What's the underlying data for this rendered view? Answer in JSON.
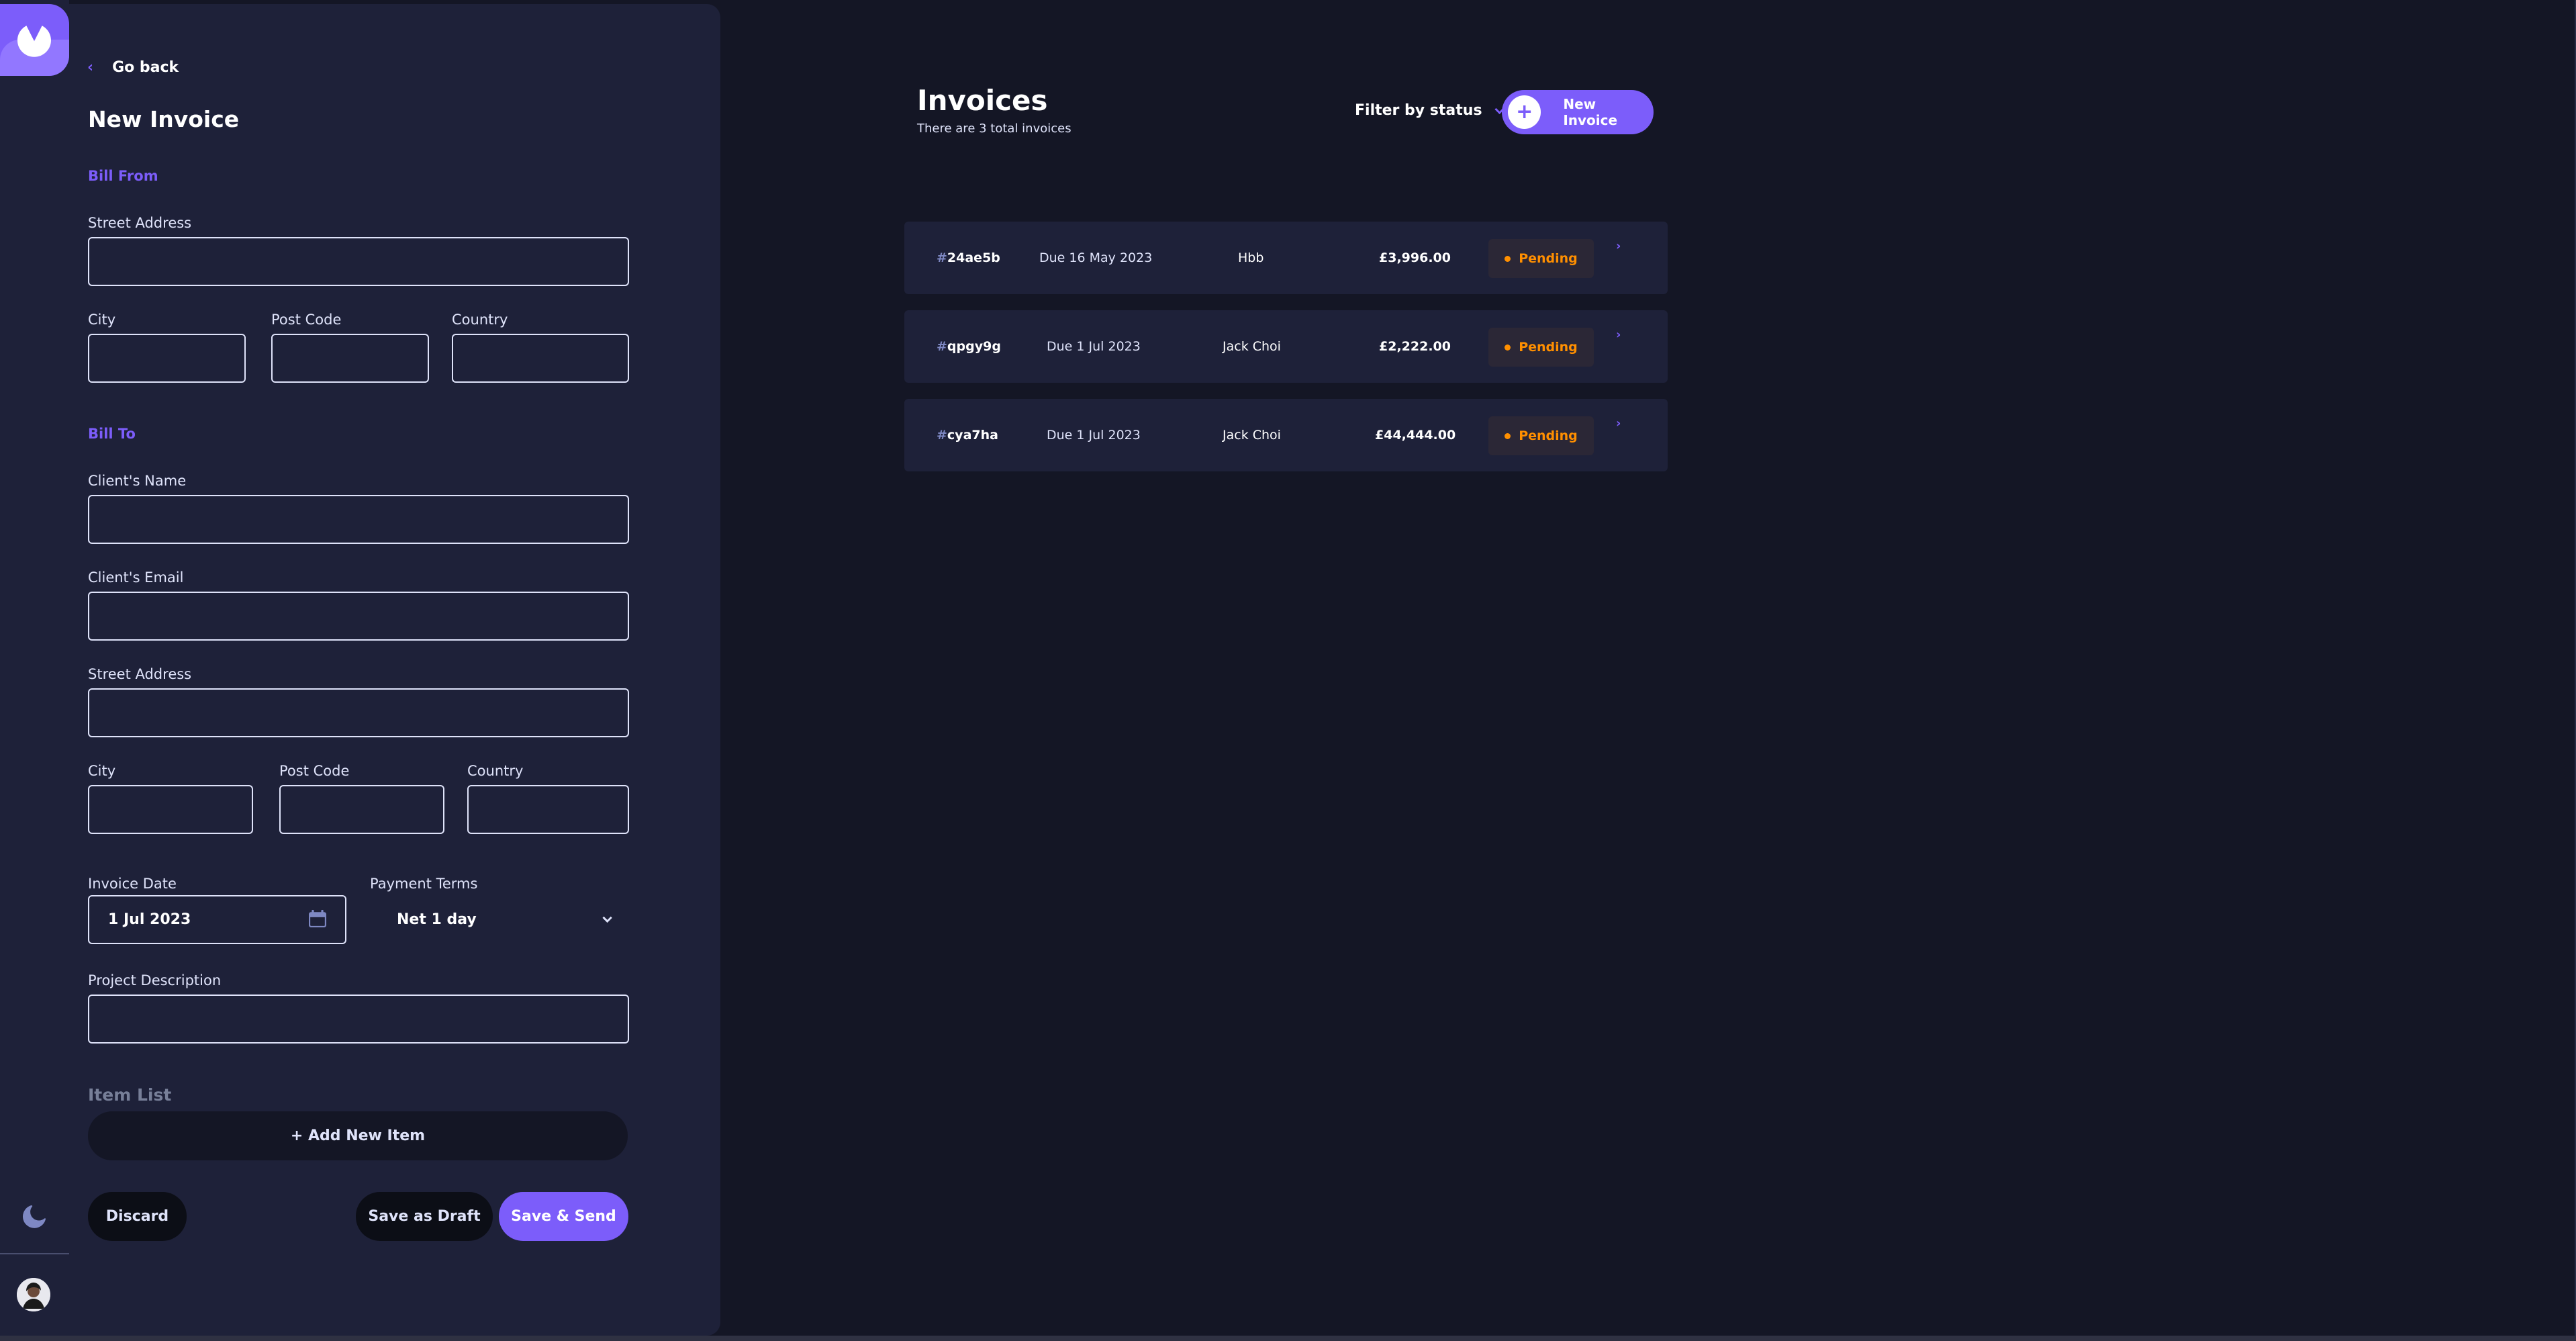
{
  "sidebar": {
    "logo_icon": "logo-icon",
    "theme_icon": "moon-icon",
    "avatar_icon": "avatar-icon"
  },
  "form": {
    "go_back": "Go back",
    "title": "New Invoice",
    "bill_from": {
      "heading": "Bill From",
      "street_label": "Street Address",
      "street_value": "",
      "city_label": "City",
      "city_value": "",
      "postcode_label": "Post Code",
      "postcode_value": "",
      "country_label": "Country",
      "country_value": ""
    },
    "bill_to": {
      "heading": "Bill To",
      "client_name_label": "Client's Name",
      "client_name_value": "",
      "client_email_label": "Client's Email",
      "client_email_value": "",
      "street_label": "Street Address",
      "street_value": "",
      "city_label": "City",
      "city_value": "",
      "postcode_label": "Post Code",
      "postcode_value": "",
      "country_label": "Country",
      "country_value": ""
    },
    "invoice_date_label": "Invoice Date",
    "invoice_date_value": "1 Jul 2023",
    "payment_terms_label": "Payment Terms",
    "payment_terms_value": "Net 1 day",
    "project_description_label": "Project Description",
    "project_description_value": "",
    "item_list_label": "Item List",
    "add_item_label": "+ Add New Item",
    "discard_label": "Discard",
    "save_draft_label": "Save as Draft",
    "save_send_label": "Save & Send"
  },
  "main": {
    "title": "Invoices",
    "subtitle": "There are 3 total invoices",
    "filter_label": "Filter by status",
    "new_invoice_label": "New Invoice",
    "invoices": [
      {
        "hash": "#",
        "id": "24ae5b",
        "due": "Due 16 May 2023",
        "client": "Hbb",
        "amount": "£3,996.00",
        "status": "Pending"
      },
      {
        "hash": "#",
        "id": "qpgy9g",
        "due": "Due 1 Jul 2023",
        "client": "Jack Choi",
        "amount": "£2,222.00",
        "status": "Pending"
      },
      {
        "hash": "#",
        "id": "cya7ha",
        "due": "Due 1 Jul 2023",
        "client": "Jack Choi",
        "amount": "£44,444.00",
        "status": "Pending"
      }
    ]
  },
  "colors": {
    "accent": "#7c5dfa",
    "accent_light": "#9277ff",
    "background": "#141625",
    "panel": "#1e2139",
    "pending": "#ff8f00"
  }
}
